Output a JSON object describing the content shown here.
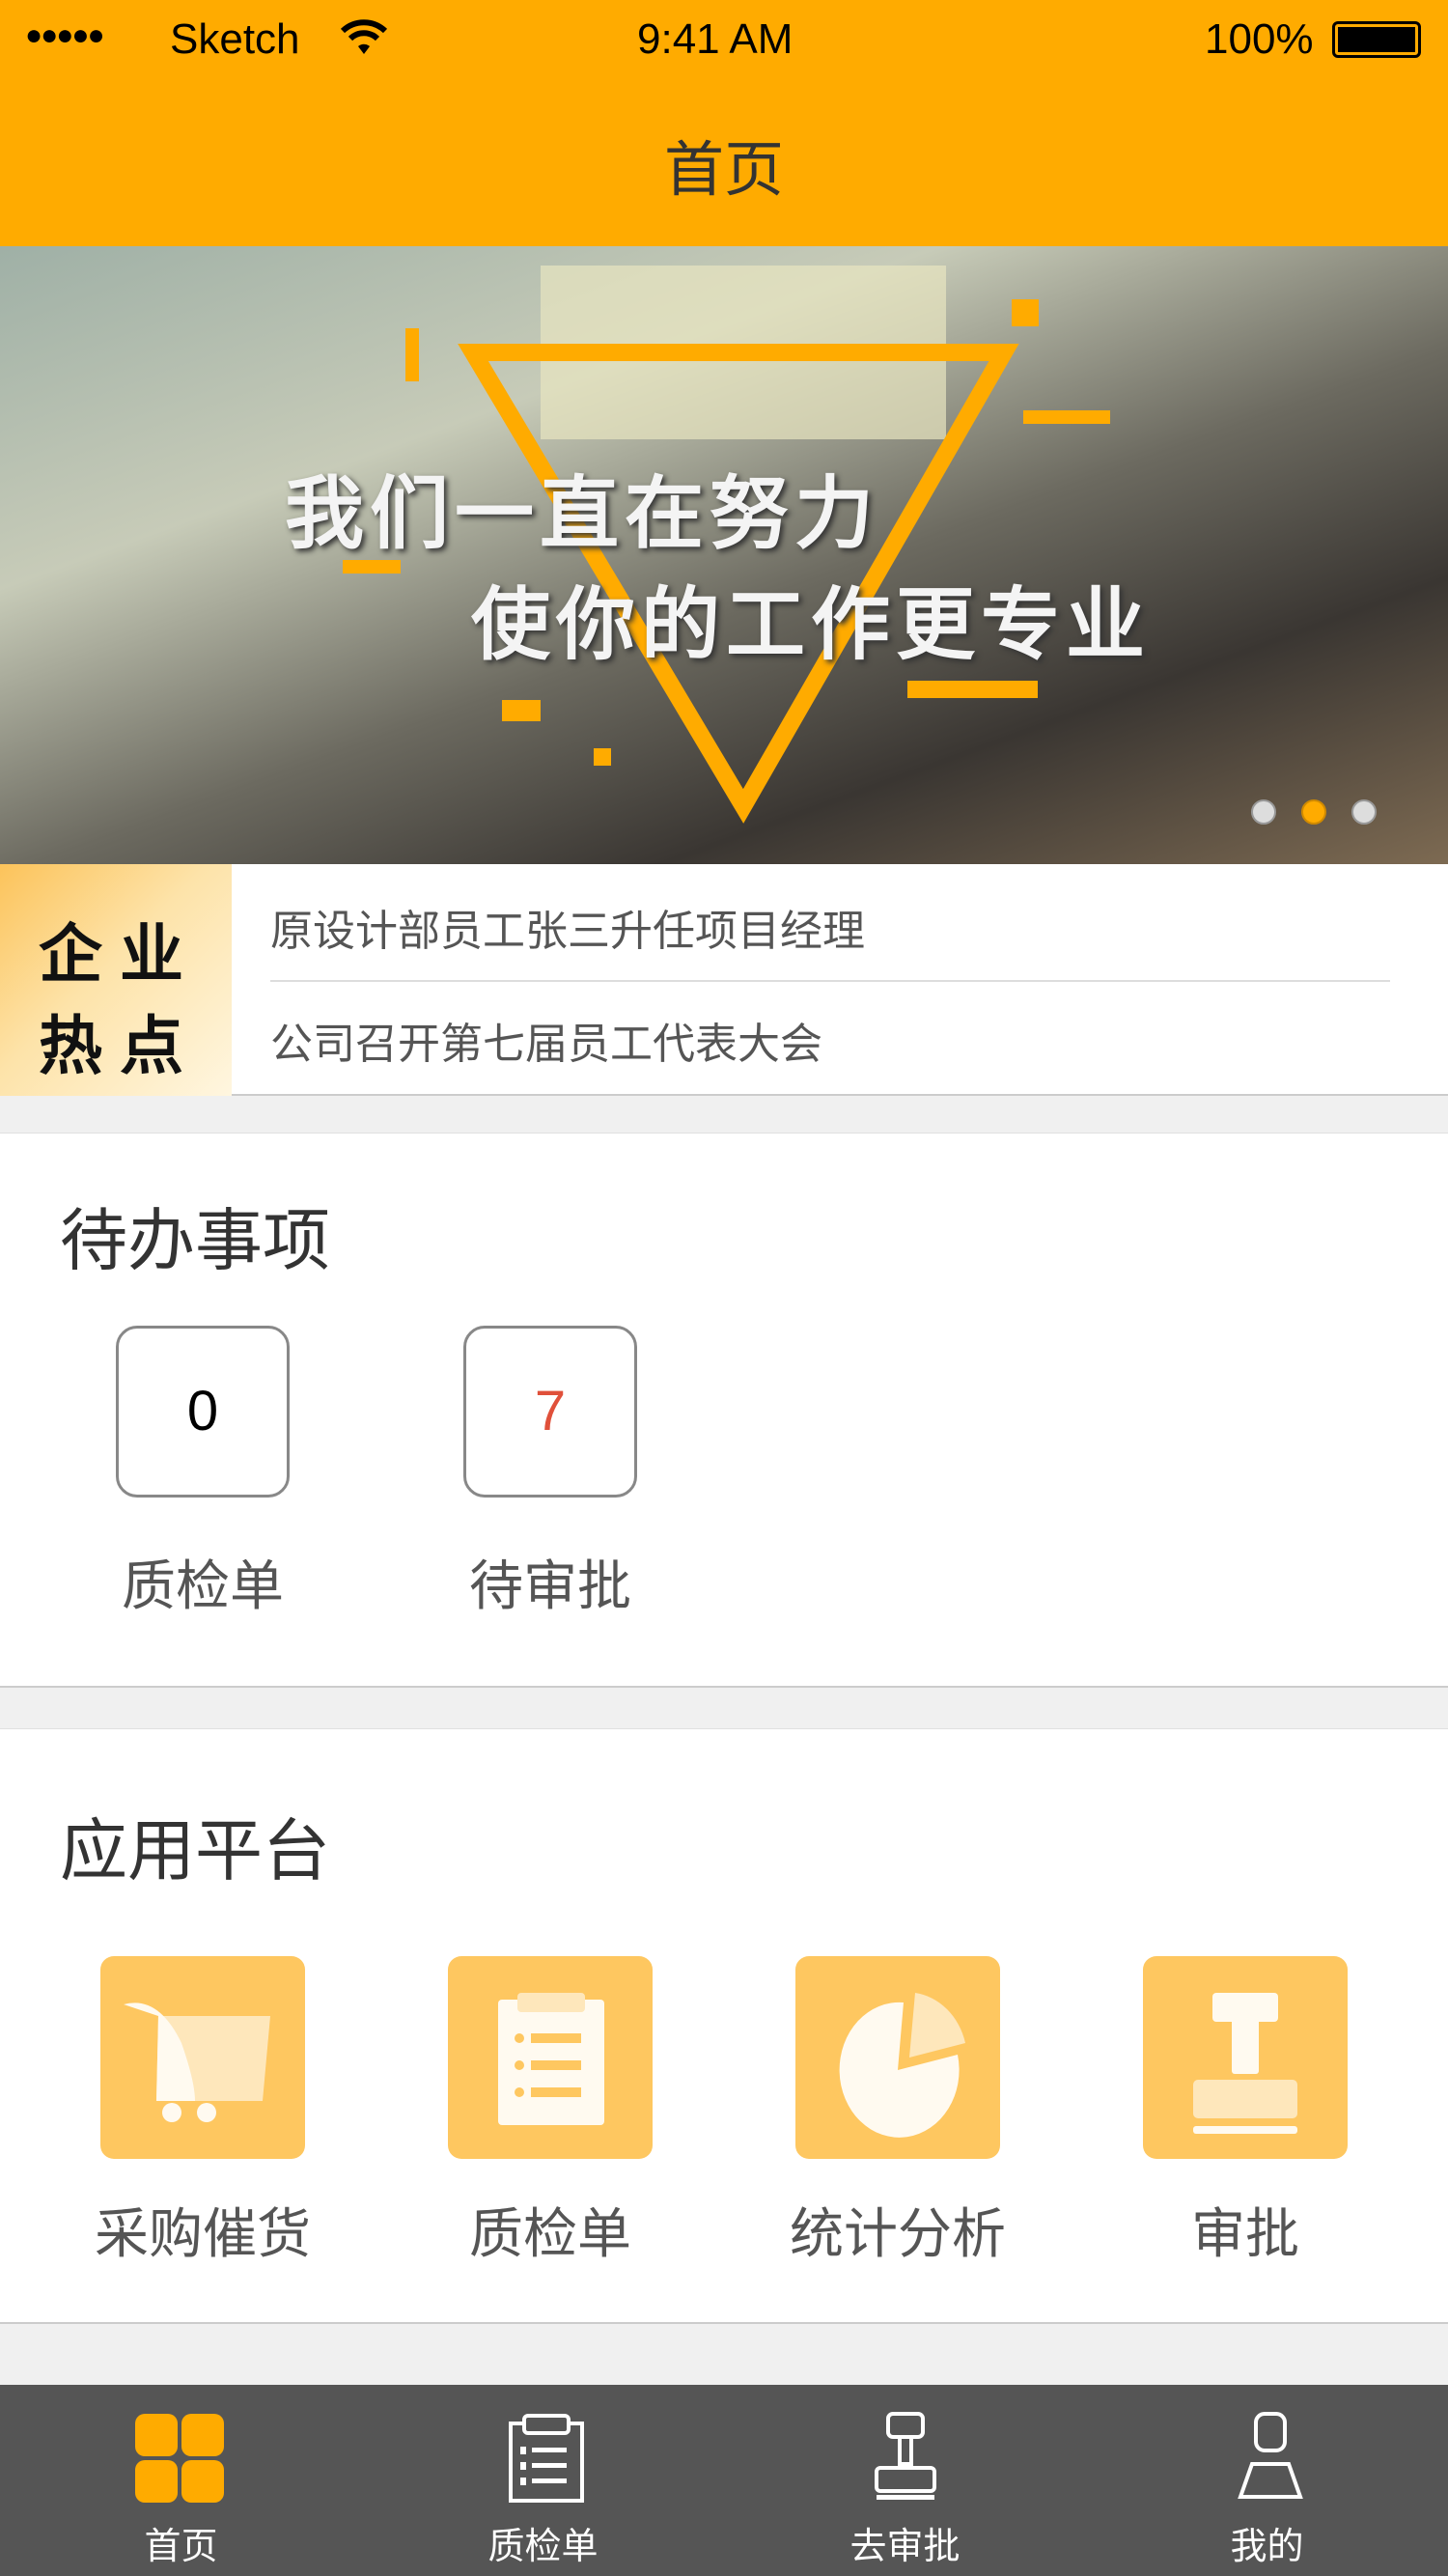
{
  "status_bar": {
    "carrier": "Sketch",
    "time": "9:41 AM",
    "battery": "100%"
  },
  "header": {
    "title": "首页"
  },
  "banner": {
    "line1": "我们一直在努力",
    "line2": "使你的工作更专业",
    "active_slide": 2,
    "slide_count": 3
  },
  "news": {
    "logo_text": "企业热点",
    "items": [
      "原设计部员工张三升任项目经理",
      "公司召开第七届员工代表大会"
    ]
  },
  "todo": {
    "title": "待办事项",
    "items": [
      {
        "count": "0",
        "label": "质检单",
        "color": "#000000"
      },
      {
        "count": "7",
        "label": "待审批",
        "color": "#e0503a"
      }
    ]
  },
  "apps": {
    "title": "应用平台",
    "items": [
      {
        "label": "采购催货",
        "icon": "cart-icon"
      },
      {
        "label": "质检单",
        "icon": "clipboard-icon"
      },
      {
        "label": "统计分析",
        "icon": "pie-chart-icon"
      },
      {
        "label": "审批",
        "icon": "stamp-icon"
      }
    ]
  },
  "tabbar": {
    "items": [
      {
        "label": "首页",
        "icon": "grid-icon",
        "active": true
      },
      {
        "label": "质检单",
        "icon": "clipboard-icon"
      },
      {
        "label": "去审批",
        "icon": "stamp-icon"
      },
      {
        "label": "我的",
        "icon": "person-icon"
      }
    ]
  },
  "colors": {
    "accent": "#ffab00",
    "app_icon": "#fec760",
    "tabbar": "#555555"
  }
}
